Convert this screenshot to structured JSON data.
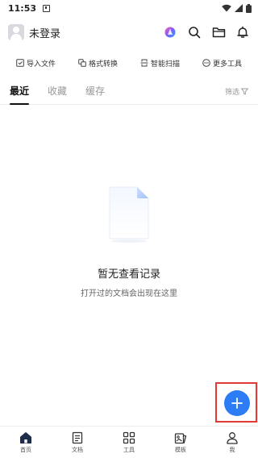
{
  "status_bar": {
    "time": "11:53"
  },
  "header": {
    "username": "未登录"
  },
  "quick_actions": [
    {
      "label": "导入文件",
      "icon": "import-icon"
    },
    {
      "label": "格式转换",
      "icon": "convert-icon"
    },
    {
      "label": "智能扫描",
      "icon": "scan-icon"
    },
    {
      "label": "更多工具",
      "icon": "more-icon"
    }
  ],
  "tabs": [
    {
      "label": "最近",
      "active": true
    },
    {
      "label": "收藏",
      "active": false
    },
    {
      "label": "缓存",
      "active": false
    }
  ],
  "filter": {
    "label": "筛选"
  },
  "empty_state": {
    "title": "暂无查看记录",
    "subtitle": "打开过的文档会出现在这里"
  },
  "bottom_nav": [
    {
      "label": "首页",
      "icon": "home-icon",
      "active": true
    },
    {
      "label": "文档",
      "icon": "document-icon",
      "active": false
    },
    {
      "label": "工具",
      "icon": "tools-icon",
      "active": false
    },
    {
      "label": "模板",
      "icon": "template-icon",
      "active": false
    },
    {
      "label": "我",
      "icon": "profile-icon",
      "active": false
    }
  ],
  "colors": {
    "accent": "#2c7cf6",
    "highlight_frame": "#e53935"
  }
}
